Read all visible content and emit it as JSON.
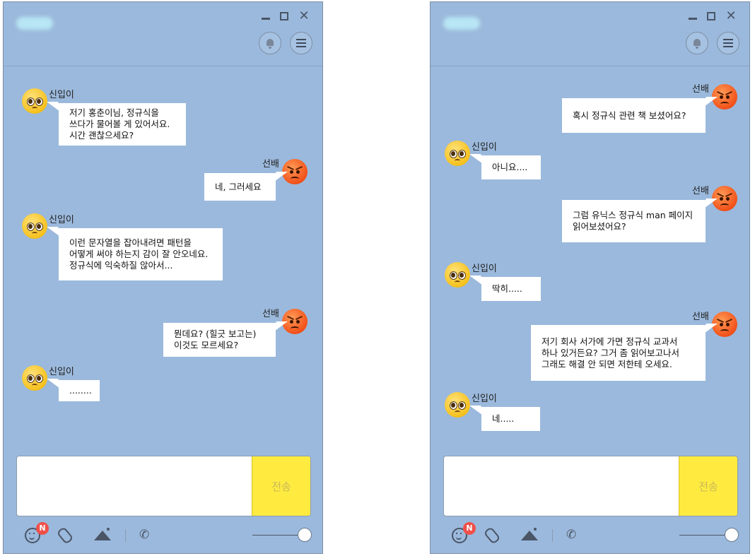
{
  "window1": {
    "send_label": "전송",
    "badge": "N",
    "messages": [
      {
        "side": "in",
        "name": "신입이",
        "text": "저기 홍춘이님, 정규식을\n쓰다가 물어볼 게 있어서요.\n시간 괜찮으세요?"
      },
      {
        "side": "out",
        "name": "선배",
        "text": "네, 그러세요"
      },
      {
        "side": "in",
        "name": "신입이",
        "text": "이런 문자열을 잡아내려면 패턴을\n어떻게 써야 하는지 감이 잘 안오네요.\n정규식에 익숙하질 않아서..."
      },
      {
        "side": "out",
        "name": "선배",
        "text": "뭔데요? (힐긋 보고는)\n이것도 모르세요?"
      },
      {
        "side": "in",
        "name": "신입이",
        "text": "........"
      }
    ]
  },
  "window2": {
    "send_label": "전송",
    "badge": "N",
    "messages": [
      {
        "side": "out",
        "name": "선배",
        "text": "혹시 정규식 관련 책 보셨어요?"
      },
      {
        "side": "in",
        "name": "신입이",
        "text": "아니요...."
      },
      {
        "side": "out",
        "name": "선배",
        "text": "그럼 유닉스 정규식 man 페이지\n읽어보셨어요?"
      },
      {
        "side": "in",
        "name": "신입이",
        "text": "딱히....."
      },
      {
        "side": "out",
        "name": "선배",
        "text": "저기 회사 서가에 가면 정규식 교과서\n하나 있거든요? 그거 좀 읽어보고나서\n그래도 해결 안 되면 저한테 오세요."
      },
      {
        "side": "in",
        "name": "신입이",
        "text": "네....."
      }
    ]
  },
  "icons": {
    "window_controls": [
      "minimize-icon",
      "maximize-icon",
      "close-icon"
    ],
    "header_buttons": [
      "bell-icon",
      "menu-icon"
    ],
    "toolbar": [
      "emoticon-icon",
      "attach-icon",
      "image-icon",
      "phone-icon"
    ],
    "close_glyph": "✕",
    "phone_glyph": "✆"
  },
  "colors": {
    "bg": "#9bb9dc",
    "send": "#ffeb40",
    "badge": "#f0504a",
    "bubble": "#ffffff"
  }
}
